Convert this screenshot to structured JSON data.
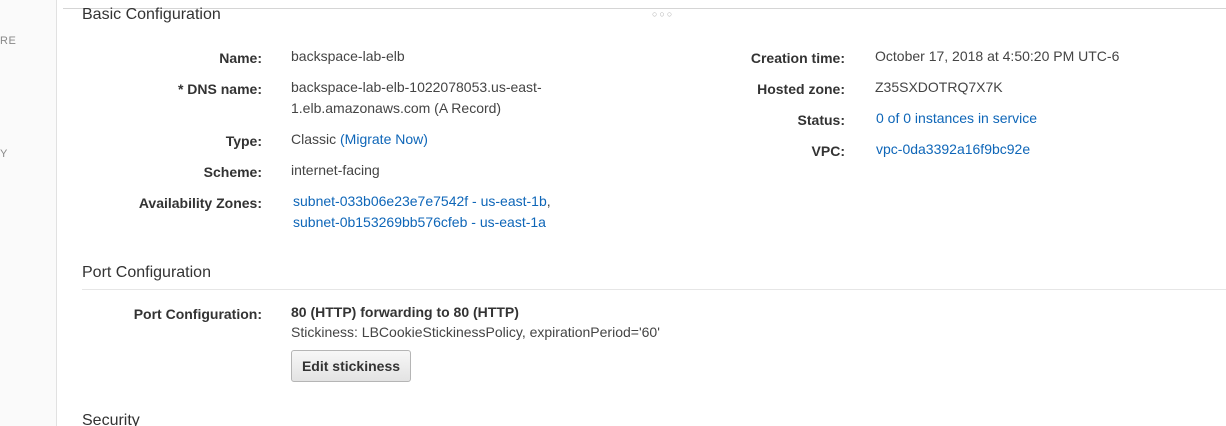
{
  "nav_fragments": [
    "RE",
    "Y"
  ],
  "basic": {
    "title": "Basic Configuration",
    "name_label": "Name:",
    "name_value": "backspace-lab-elb",
    "dns_label": "* DNS name:",
    "dns_line1": "backspace-lab-elb-1022078053.us-east-",
    "dns_line2": "1.elb.amazonaws.com (A Record)",
    "type_label": "Type:",
    "type_value": "Classic",
    "migrate_link": "(Migrate Now)",
    "scheme_label": "Scheme:",
    "scheme_value": "internet-facing",
    "az_label": "Availability Zones:",
    "az_1": "subnet-033b06e23e7e7542f - us-east-1b",
    "az_1_sep": ",",
    "az_2": "subnet-0b153269bb576cfeb - us-east-1a",
    "creation_label": "Creation time:",
    "creation_value": "October 17, 2018 at 4:50:20 PM UTC-6",
    "hosted_label": "Hosted zone:",
    "hosted_value": "Z35SXDOTRQ7X7K",
    "status_label": "Status:",
    "status_value": "0 of 0 instances in service",
    "vpc_label": "VPC:",
    "vpc_value": "vpc-0da3392a16f9bc92e"
  },
  "port": {
    "title": "Port Configuration",
    "label": "Port Configuration:",
    "forwarding": "80 (HTTP) forwarding to 80 (HTTP)",
    "stickiness": "Stickiness: LBCookieStickinessPolicy, expirationPeriod='60'",
    "edit_button": "Edit stickiness"
  },
  "security": {
    "title": "Security"
  }
}
